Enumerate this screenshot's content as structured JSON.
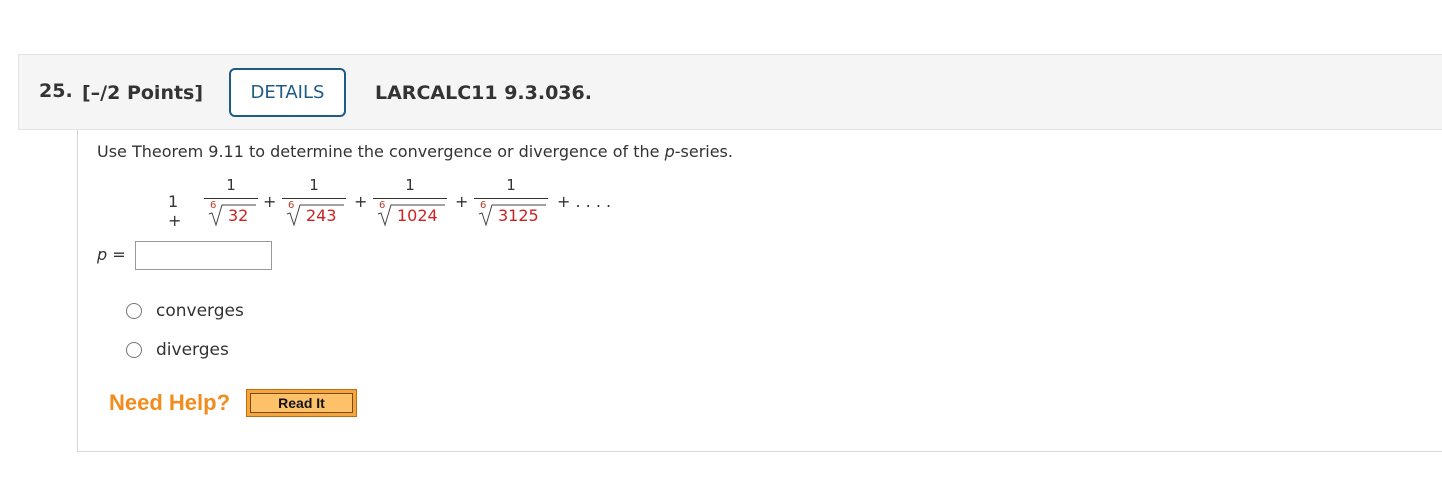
{
  "question": {
    "number": "25.",
    "points": "[–/2 Points]",
    "details_label": "DETAILS",
    "reference": "LARCALC11 9.3.036."
  },
  "prompt": {
    "before": "Use Theorem 9.11 to determine the convergence or divergence of the ",
    "variable": "p",
    "after": "-series."
  },
  "series": {
    "leading_term": "1 +",
    "terms": [
      {
        "numerator": "1",
        "root_index": "6",
        "radicand": "32"
      },
      {
        "numerator": "1",
        "root_index": "6",
        "radicand": "243"
      },
      {
        "numerator": "1",
        "root_index": "6",
        "radicand": "1024"
      },
      {
        "numerator": "1",
        "root_index": "6",
        "radicand": "3125"
      }
    ],
    "plus": "+",
    "ellipsis": "+ . . . ."
  },
  "answer": {
    "p_label": "p =",
    "p_value": ""
  },
  "options": [
    "converges",
    "diverges"
  ],
  "help": {
    "need_help": "Need Help?",
    "read_it": "Read It"
  },
  "colors": {
    "details_border": "#1f5c85",
    "radical_red": "#cc2222",
    "need_help_orange": "#f28c1e",
    "read_it_bg": "#fdc169"
  }
}
